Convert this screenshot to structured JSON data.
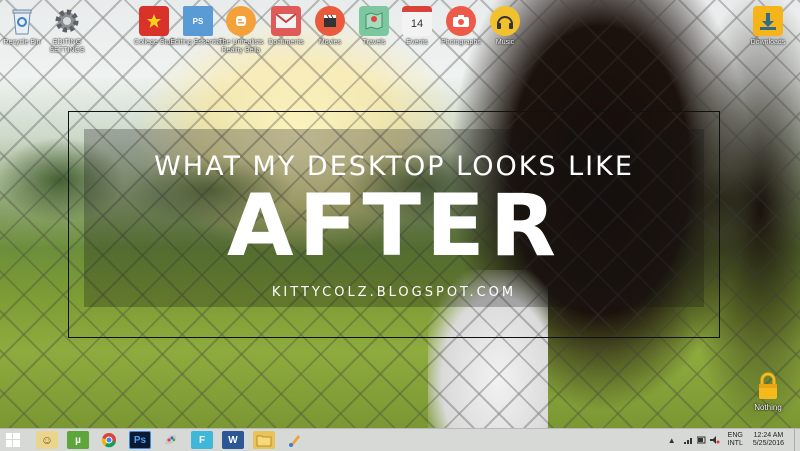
{
  "overlay": {
    "subtitle": "WHAT MY DESKTOP LOOKS LIKE",
    "title": "AFTER",
    "url": "KITTYCOLZ.BLOGSPOT.COM"
  },
  "desktop_icons": {
    "recycle_bin": "Recycle Bin",
    "settings": "EDITING SETTINGS",
    "college_stuff": "College Stuff",
    "editing_essentials": "Editing Essentials",
    "the_unrealists": "The Unrealists Reality Bella",
    "documents": "Documents",
    "movies": "Movies",
    "travels": "Travels",
    "events": "Events",
    "events_day": "14",
    "photographs": "Photographs",
    "music": "Music",
    "downloads": "Downloads",
    "nothing": "Nothing",
    "ps_badge": "PS"
  },
  "taskbar": {
    "apps": [
      "explorer",
      "utorrent",
      "chrome",
      "photoshop",
      "paint",
      "flipboard",
      "word",
      "folder",
      "paint-brush"
    ],
    "photoshop_label": "Ps",
    "flip_label": "F",
    "word_label": "W",
    "utorrent_label": "µ",
    "language_top": "ENG",
    "language_bottom": "INTL",
    "time": "12:24 AM",
    "date": "5/25/2016"
  },
  "colors": {
    "taskbar_bg": "#d2d6d2",
    "overlay_text": "#ffffff"
  }
}
